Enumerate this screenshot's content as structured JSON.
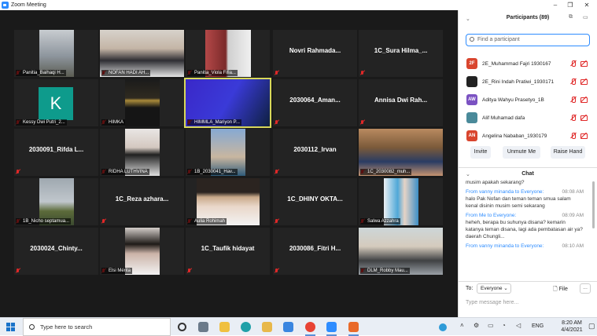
{
  "window": {
    "title": "Zoom Meeting"
  },
  "tiles": [
    {
      "label": "Panitia_Baihaqi H...",
      "name": "",
      "kind": "photo"
    },
    {
      "label": "NOFAN HADI AH...",
      "name": "",
      "kind": "photo"
    },
    {
      "label": "Panitia_Viola Fifia...",
      "name": "",
      "kind": "photo"
    },
    {
      "label": "",
      "name": "Novri Rahmada...",
      "kind": "name"
    },
    {
      "label": "",
      "name": "1C_Sura Hilma_...",
      "kind": "name"
    },
    {
      "label": "Kessy Dwi Putri_2...",
      "name": "",
      "kind": "k"
    },
    {
      "label": "HIMKA",
      "name": "",
      "kind": "photo"
    },
    {
      "label": "HIMMLA_Mariyon P...",
      "name": "",
      "kind": "photo",
      "active": true
    },
    {
      "label": "",
      "name": "2030064_Aman...",
      "kind": "name"
    },
    {
      "label": "",
      "name": "Annisa Dwi Rah...",
      "kind": "name"
    },
    {
      "label": "",
      "name": "2030091_Rifda L...",
      "kind": "name"
    },
    {
      "label": "RIDHA LUTHVINA",
      "name": "",
      "kind": "photo"
    },
    {
      "label": "1B_2030041_Hav...",
      "name": "",
      "kind": "photo"
    },
    {
      "label": "",
      "name": "2030112_Irvan",
      "kind": "name"
    },
    {
      "label": "1C_2030082_muh...",
      "name": "",
      "kind": "photo"
    },
    {
      "label": "1B_Nicho septamua...",
      "name": "",
      "kind": "photo"
    },
    {
      "label": "",
      "name": "1C_Reza azhara...",
      "kind": "name"
    },
    {
      "label": "Aulia Rohimah",
      "name": "",
      "kind": "photo"
    },
    {
      "label": "",
      "name": "1C_DHINY OKTA...",
      "kind": "name"
    },
    {
      "label": "Salwa Azzahra",
      "name": "",
      "kind": "photo"
    },
    {
      "label": "",
      "name": "2030024_Chinty...",
      "kind": "name"
    },
    {
      "label": "Elsi Mérita",
      "name": "",
      "kind": "photo"
    },
    {
      "label": "",
      "name": "1C_Taufik hidayat",
      "kind": "name"
    },
    {
      "label": "",
      "name": "2030086_Fitri H...",
      "kind": "name"
    },
    {
      "label": "DLM_Robby Mau...",
      "name": "",
      "kind": "photo"
    }
  ],
  "participants": {
    "title": "Participants (89)",
    "search_placeholder": "Find a participant",
    "list": [
      {
        "initials": "2F",
        "name": "2E_Muhammad Fajri 1930167",
        "color": "#d9452e"
      },
      {
        "initials": "",
        "name": "2E_Rini Indah Pratiwi_1930171",
        "color": "#222222"
      },
      {
        "initials": "AW",
        "name": "Aditya Wahyu Prasetyo_1B",
        "color": "#7b52c2"
      },
      {
        "initials": "",
        "name": "Alif Muhamad dafa",
        "color": "#4a8a9a"
      },
      {
        "initials": "AN",
        "name": "Angelina Nababan_1930179",
        "color": "#d9452e"
      }
    ],
    "invite": "Invite",
    "unmute_me": "Unmute Me",
    "raise_hand": "Raise Hand"
  },
  "chat": {
    "title": "Chat",
    "messages": [
      {
        "from": "",
        "time": "",
        "text": "musim apakah sekarang?"
      },
      {
        "from": "From vanny minanda to Everyone:",
        "time": "08:08 AM",
        "text": "halo Pak Nofan dan teman teman smua salam kenal disinin musim semi sekarang"
      },
      {
        "from": "From Me to Everyone:",
        "time": "08:09 AM",
        "text": "heheh, berapa bu suhunya disana? kemarin katanya teman disana, lagi ada pembatasan air ya? daerah Chungli..."
      },
      {
        "from": "From vanny minanda to Everyone:",
        "time": "08:10 AM",
        "text": ""
      }
    ],
    "to_label": "To:",
    "to_value": "Everyone",
    "file_label": "File",
    "more": "...",
    "input_placeholder": "Type message here..."
  },
  "taskbar": {
    "search_placeholder": "Type here to search",
    "lang": "ENG",
    "time": "8:20 AM",
    "date": "4/4/2021"
  }
}
